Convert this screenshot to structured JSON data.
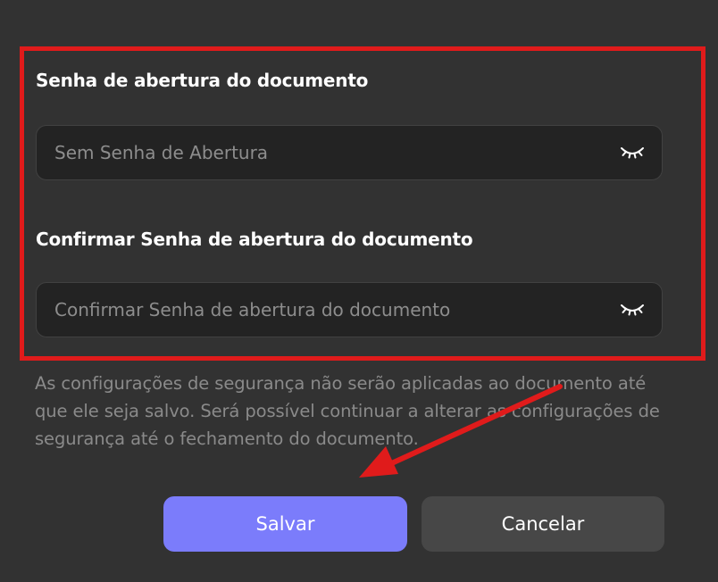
{
  "dialog": {
    "open_password_label": "Senha de abertura do documento",
    "open_password_placeholder": "Sem Senha de Abertura",
    "confirm_password_label": "Confirmar Senha de abertura do documento",
    "confirm_password_placeholder": "Confirmar Senha de abertura do documento",
    "help_text": "As configurações de segurança não serão aplicadas ao documento até que ele seja salvo. Será possível continuar a alterar as configurações de segurança até o fechamento do documento.",
    "save_label": "Salvar",
    "cancel_label": "Cancelar"
  },
  "icons": {
    "password_toggle": "eye-closed-icon"
  },
  "colors": {
    "background": "#323232",
    "field_background": "#232323",
    "primary_button": "#7b7cfb",
    "secondary_button": "#474747",
    "annotation_red": "#e01b1b"
  }
}
